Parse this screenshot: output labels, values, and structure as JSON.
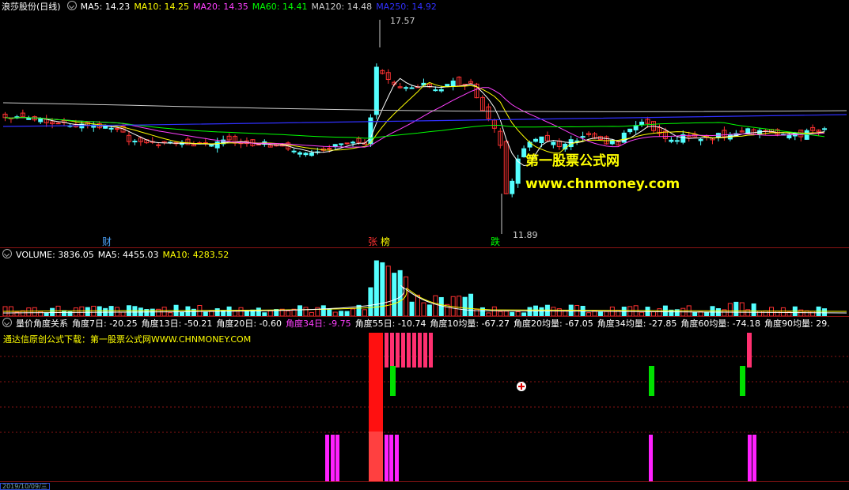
{
  "main_pane": {
    "title": "浪莎股份(日线)",
    "indicators": [
      {
        "label": "MA5: 14.23",
        "color": "#ffffff"
      },
      {
        "label": "MA10: 14.25",
        "color": "#ffff00"
      },
      {
        "label": "MA20: 14.35",
        "color": "#ff40ff"
      },
      {
        "label": "MA60: 14.41",
        "color": "#00ff00"
      },
      {
        "label": "MA120: 14.48",
        "color": "#cccccc"
      },
      {
        "label": "MA250: 14.92",
        "color": "#3030ff"
      }
    ],
    "high_label": "17.57",
    "low_label": "11.89",
    "event_marks": [
      {
        "text": "财",
        "color": "#4da6ff"
      },
      {
        "text": "张",
        "color": "#ff3030"
      },
      {
        "text": "榜",
        "color": "#ffff00"
      },
      {
        "text": "跌",
        "color": "#00ff00"
      }
    ]
  },
  "watermark": {
    "site_name": "第一股票公式网",
    "url": "www.chnmoney.com"
  },
  "volume_pane": {
    "labels": [
      {
        "label": "VOLUME: 3836.05",
        "color": "#ffffff"
      },
      {
        "label": "MA5: 4455.03",
        "color": "#ffffff"
      },
      {
        "label": "MA10: 4283.52",
        "color": "#ffff00"
      }
    ]
  },
  "indicator_pane": {
    "title": "量价角度关系",
    "values": [
      {
        "label": "角度7日: -20.25",
        "color": "#ffffff"
      },
      {
        "label": "角度13日: -50.21",
        "color": "#ffffff"
      },
      {
        "label": "角度20日: -0.60",
        "color": "#ffffff"
      },
      {
        "label": "角度34日: -9.75",
        "color": "#ff40ff"
      },
      {
        "label": "角度55日: -10.74",
        "color": "#ffffff"
      },
      {
        "label": "角度10均量: -67.27",
        "color": "#ffffff"
      },
      {
        "label": "角度20均量: -67.05",
        "color": "#ffffff"
      },
      {
        "label": "角度34均量: -27.85",
        "color": "#ffffff"
      },
      {
        "label": "角度60均量: -74.18",
        "color": "#ffffff"
      },
      {
        "label": "角度90均量: 29.",
        "color": "#ffffff"
      }
    ],
    "note": "通达信原创公式下载：第一股票公式网WWW.CHNMONEY.COM"
  },
  "date_axis": {
    "cursor_date": "2019/10/09/三"
  },
  "colors": {
    "up": "#ff3232",
    "down": "#54ffff",
    "grid": "#8a1414",
    "bar_red": "#ff1010",
    "bar_pink": "#ff3070",
    "bar_green": "#00e000",
    "bar_magenta": "#ff20ff"
  }
}
